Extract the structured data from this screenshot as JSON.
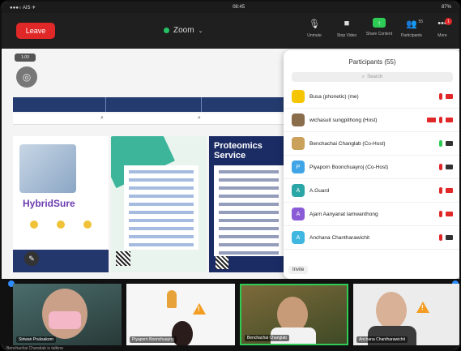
{
  "statusbar": {
    "left": "●●●○ AIS  ✈",
    "time": "08:45",
    "battery": "87%"
  },
  "toolbar": {
    "leave_label": "Leave",
    "app_name": "Zoom",
    "tools": [
      {
        "label": "Unmute",
        "icon": "mic-icon"
      },
      {
        "label": "Stop Video",
        "icon": "video-icon"
      },
      {
        "label": "Share Content",
        "icon": "share-screen-icon"
      },
      {
        "label": "Participants",
        "icon": "participants-icon",
        "count": "55"
      },
      {
        "label": "More",
        "icon": "more-icon",
        "badge": "1"
      }
    ]
  },
  "content": {
    "rec_label": "1:00"
  },
  "posters": {
    "p1_title": "HybridSure",
    "p3_title": "Proteomics Service"
  },
  "participants": {
    "title": "Participants (55)",
    "search_placeholder": "Search",
    "invite_label": "Invite",
    "list": [
      {
        "name": "Busa (phonetic) (me)",
        "avatar_color": "#f5c600",
        "avatar_text": "",
        "mic": "red",
        "video": "off"
      },
      {
        "name": "wichasuit sungpithong (Host)",
        "avatar_color": "#8a6d4b",
        "avatar_text": "",
        "mic": "red",
        "video": "off",
        "share": true
      },
      {
        "name": "Benchachai Changlab (Co-Host)",
        "avatar_color": "#c9a15a",
        "avatar_text": "",
        "mic": "green",
        "video": "on"
      },
      {
        "name": "Piyaporn Boonchuayroj (Co-Host)",
        "avatar_color": "#3fa5e6",
        "avatar_text": "P",
        "mic": "red",
        "video": "on"
      },
      {
        "name": "A.Guard",
        "avatar_color": "#2ba6a6",
        "avatar_text": "A",
        "mic": "red",
        "video": "off"
      },
      {
        "name": "Ajarn Aanyanat lamwanthong",
        "avatar_color": "#8a5bd6",
        "avatar_text": "A",
        "mic": "red",
        "video": "off"
      },
      {
        "name": "Anchana Chantharawichit",
        "avatar_color": "#3fb7e0",
        "avatar_text": "A",
        "mic": "red",
        "video": "on"
      }
    ]
  },
  "gallery": {
    "caption": "Benchachai Changlab is talking",
    "tiles": [
      {
        "name": "Siriwan Pruksakorn"
      },
      {
        "name": "Piyaporn Boonchuayroj"
      },
      {
        "name": "Benchachai Changlab"
      },
      {
        "name": "Anchana Chantharawichit"
      }
    ]
  }
}
